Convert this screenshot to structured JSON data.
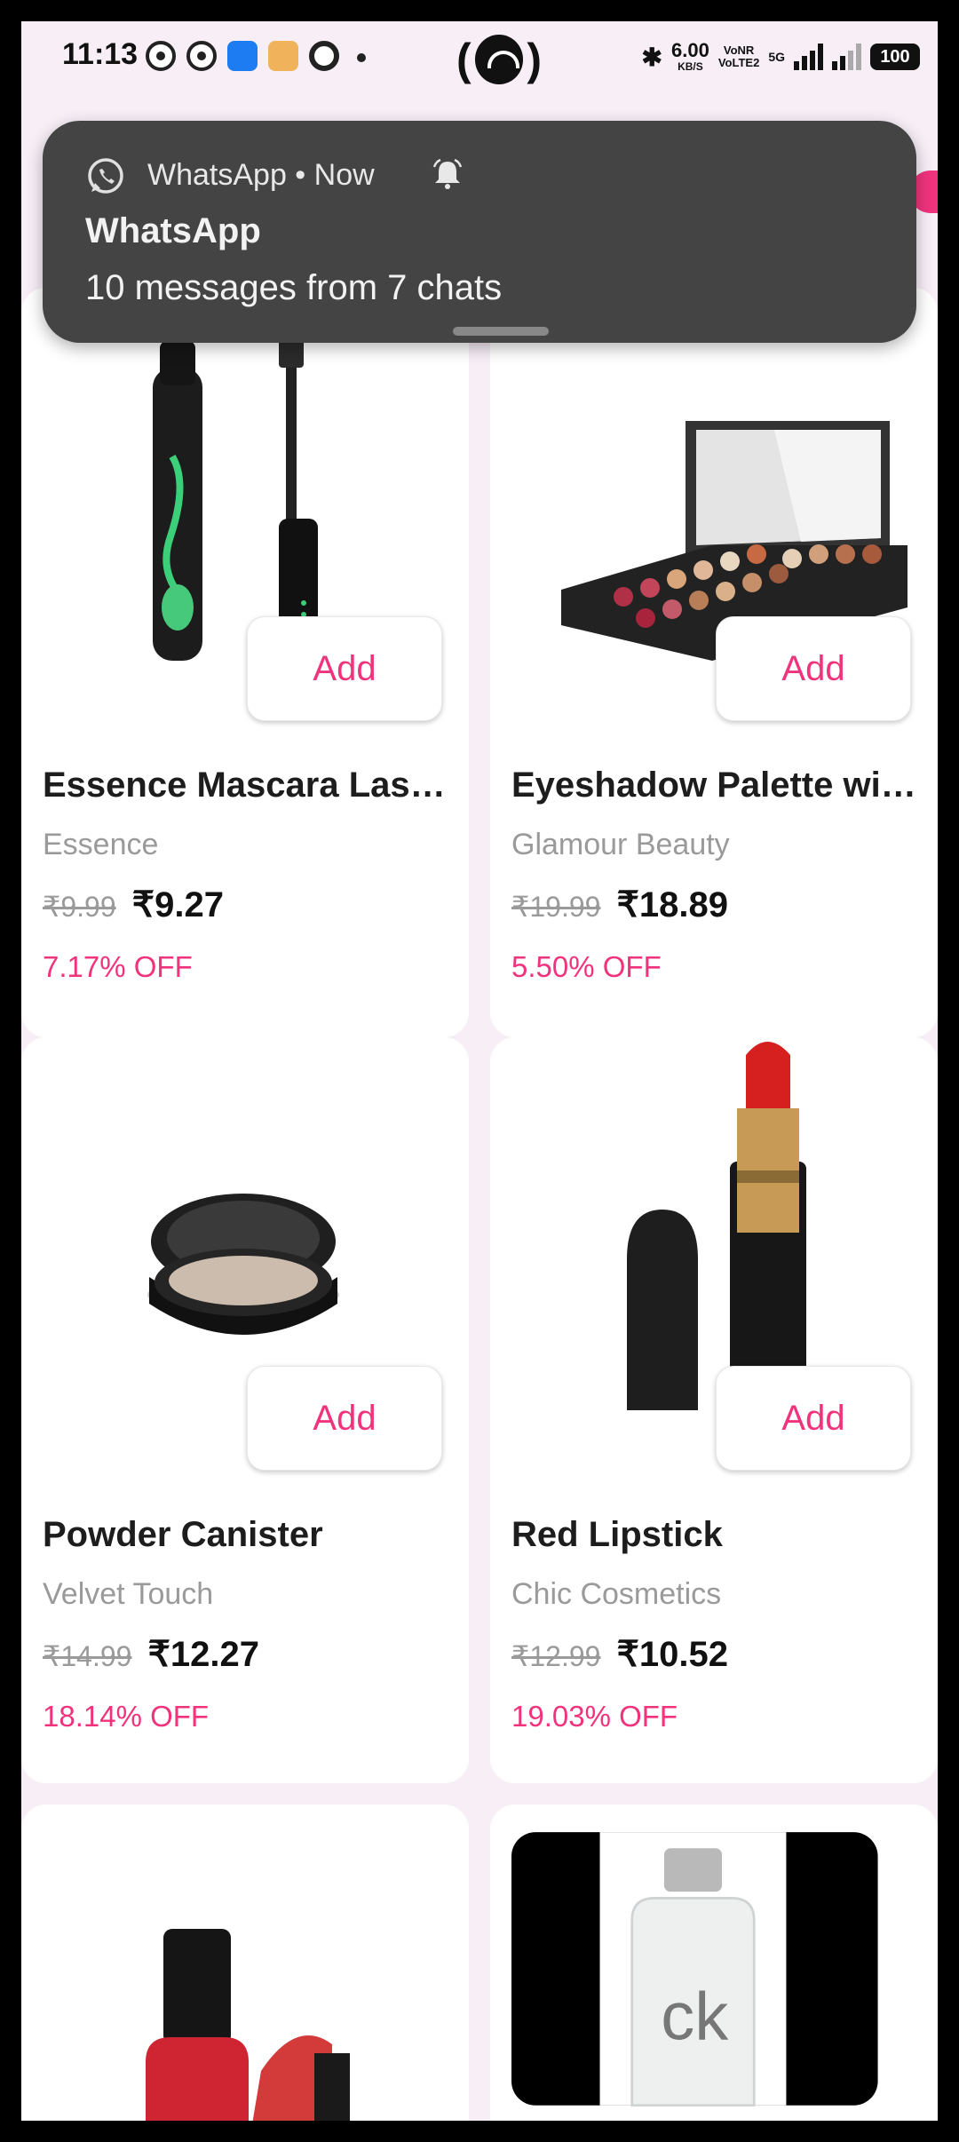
{
  "status_bar": {
    "time": "11:13",
    "net_speed_value": "6.00",
    "net_speed_unit": "KB/S",
    "volte1": "VoNR",
    "volte2": "VoLTE2",
    "network": "5G",
    "battery": "100"
  },
  "notification": {
    "app": "WhatsApp",
    "header": "WhatsApp • Now",
    "title": "WhatsApp",
    "body": "10 messages from 7 chats"
  },
  "products": [
    {
      "title": "Essence Mascara Las…",
      "brand": "Essence",
      "old_price": "₹9.99",
      "new_price": "₹9.27",
      "discount": "7.17% OFF",
      "add_label": "Add"
    },
    {
      "title": "Eyeshadow Palette wi…",
      "brand": "Glamour Beauty",
      "old_price": "₹19.99",
      "new_price": "₹18.89",
      "discount": "5.50% OFF",
      "add_label": "Add"
    },
    {
      "title": "Powder Canister",
      "brand": "Velvet Touch",
      "old_price": "₹14.99",
      "new_price": "₹12.27",
      "discount": "18.14% OFF",
      "add_label": "Add"
    },
    {
      "title": "Red Lipstick",
      "brand": "Chic Cosmetics",
      "old_price": "₹12.99",
      "new_price": "₹10.52",
      "discount": "19.03% OFF",
      "add_label": "Add"
    }
  ],
  "colors": {
    "accent": "#f0337d",
    "background": "#f7eef6",
    "notification": "#444444"
  }
}
